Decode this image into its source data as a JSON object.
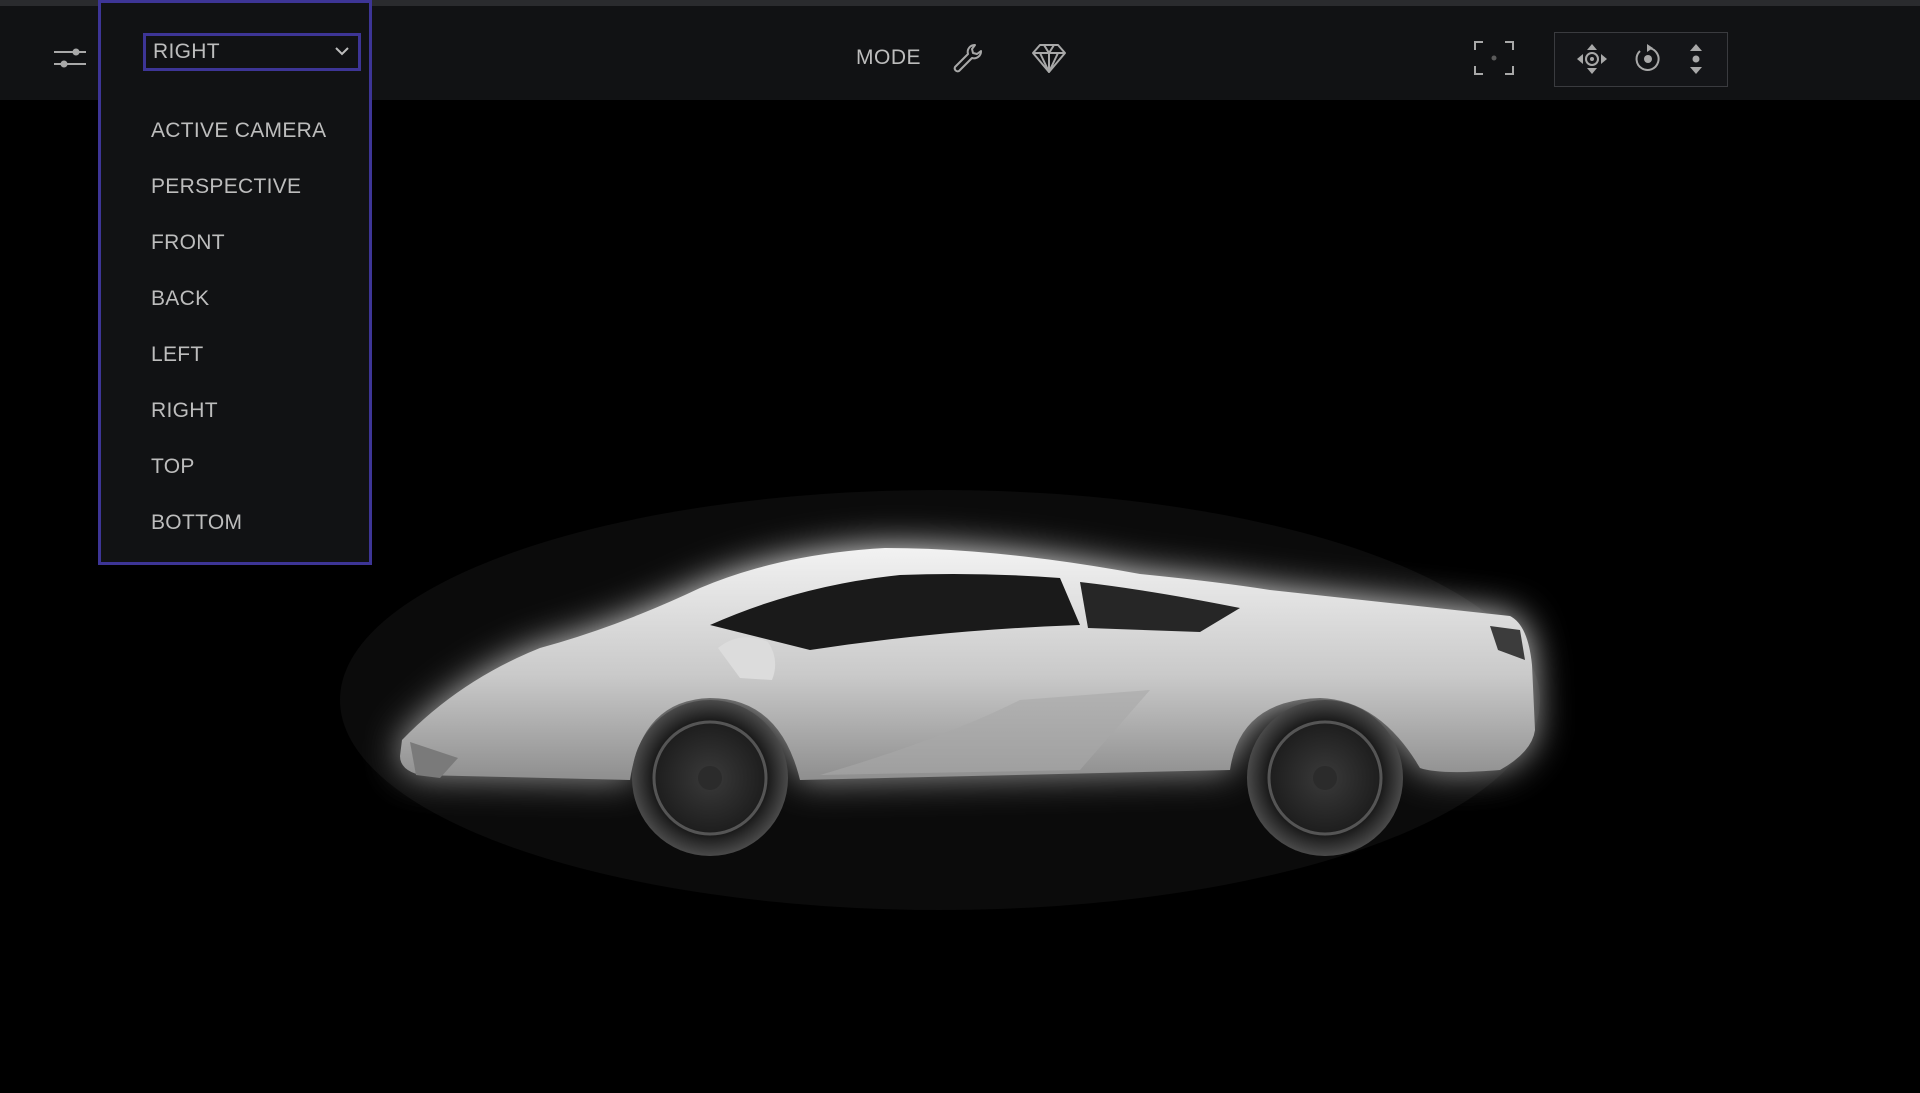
{
  "toolbar": {
    "settings_icon": "sliders-icon",
    "view_select": {
      "value": "RIGHT",
      "chevron_icon": "chevron-down-icon"
    },
    "mode_label": "MODE",
    "mode_icons": [
      "wrench-icon",
      "diamond-icon"
    ],
    "frame_icon": "focus-frame-icon",
    "nav_icons": [
      "move-icon",
      "orbit-icon",
      "up-down-icon"
    ]
  },
  "dropdown": {
    "options": [
      "ACTIVE CAMERA",
      "PERSPECTIVE",
      "FRONT",
      "BACK",
      "LEFT",
      "RIGHT",
      "TOP",
      "BOTTOM"
    ],
    "selected": "RIGHT"
  },
  "viewport": {
    "subject": "car-model"
  },
  "colors": {
    "accent": "#3d3596",
    "toolbar_bg": "#111214",
    "viewport_bg": "#000000",
    "text": "#bdbdbd"
  }
}
